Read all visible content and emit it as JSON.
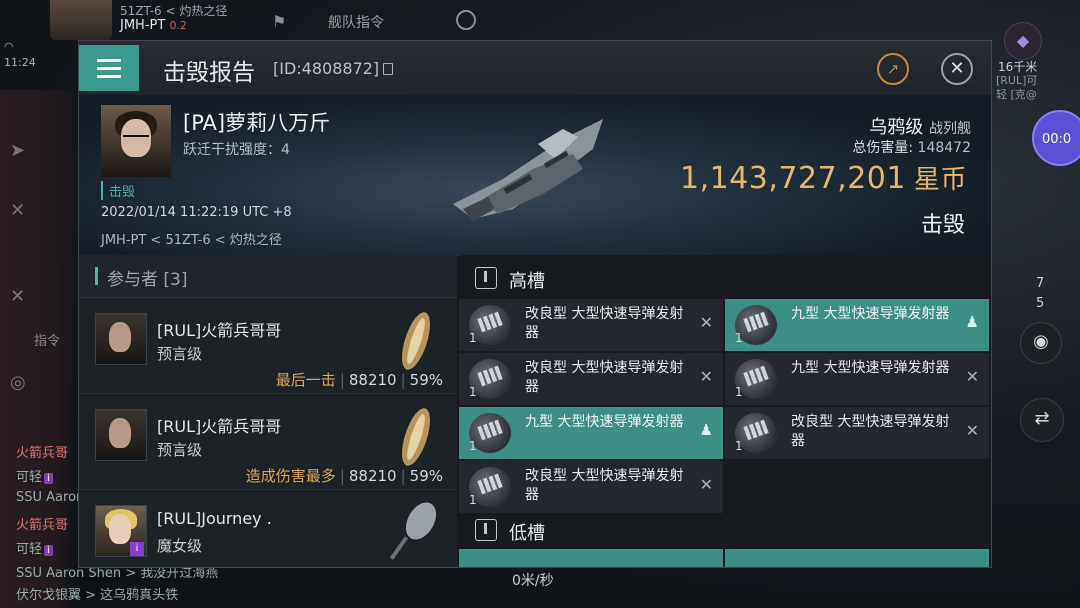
{
  "hud": {
    "location_line1": "51ZT-6 < 灼热之径",
    "location_system": "JMH-PT",
    "security": "0.2",
    "wifi": "",
    "time": "11:24",
    "fleet_label": "舰队指令",
    "right_distance": "16千米",
    "right_rul_line1": "[RUL]可",
    "right_rul_line2": "轻 [克@",
    "speed_button": "00:0",
    "right_count_1": "7",
    "right_count_2": "5",
    "side_label": "指令",
    "speed_bottom": "0米/秒",
    "chat": [
      {
        "name": "火箭兵哥",
        "text": ""
      },
      {
        "name": "",
        "text": "可轻",
        "tag": "i"
      },
      {
        "name": "",
        "text": "SSU Aaron"
      },
      {
        "name": "火箭兵哥",
        "text": ""
      },
      {
        "name": "",
        "text": "可轻",
        "tag": "i"
      },
      {
        "name": "",
        "text": "SSU Aaron Shen > 我没开过海燕"
      },
      {
        "name": "",
        "text": "伏尔戈银翼 > 这乌鸦真头铁"
      }
    ]
  },
  "report": {
    "title": "击毁报告",
    "id": "[ID:4808872]",
    "victim": {
      "name": "[PA]萝莉八万斤",
      "warp": "跃迁干扰强度：4",
      "status": "击毁",
      "datetime": "2022/01/14 11:22:19 UTC +8",
      "location": "JMH-PT < 51ZT-6 < 灼热之径",
      "ship": "乌鸦级",
      "ship_class": "战列舰",
      "damage_label": "总伤害量:",
      "damage_value": "148472",
      "isk_value": "1,143,727,201",
      "isk_unit": "星币",
      "result": "击毁"
    },
    "participants": {
      "title": "参与者 [3]",
      "rows": [
        {
          "name": "[RUL]火箭兵哥哥",
          "ship": "预言级",
          "tag": "最后一击",
          "damage": "88210",
          "percent": "59%"
        },
        {
          "name": "[RUL]火箭兵哥哥",
          "ship": "预言级",
          "tag": "造成伤害最多",
          "damage": "88210",
          "percent": "59%"
        },
        {
          "name": "[RUL]Journey .",
          "ship": "魔女级",
          "tag": "",
          "damage": "",
          "percent": ""
        }
      ]
    },
    "high_slots": {
      "title": "高槽",
      "modules": [
        {
          "name": "改良型 大型快速导弹发射器",
          "qty": "1",
          "highlight": false,
          "state": "destroyed"
        },
        {
          "name": "九型 大型快速导弹发射器",
          "qty": "1",
          "highlight": true,
          "state": "dropped"
        },
        {
          "name": "改良型 大型快速导弹发射器",
          "qty": "1",
          "highlight": false,
          "state": "destroyed"
        },
        {
          "name": "九型 大型快速导弹发射器",
          "qty": "1",
          "highlight": false,
          "state": "destroyed"
        },
        {
          "name": "九型 大型快速导弹发射器",
          "qty": "1",
          "highlight": true,
          "state": "dropped"
        },
        {
          "name": "改良型 大型快速导弹发射器",
          "qty": "1",
          "highlight": false,
          "state": "destroyed"
        },
        {
          "name": "改良型 大型快速导弹发射器",
          "qty": "1",
          "highlight": false,
          "state": "destroyed"
        }
      ]
    },
    "low_slots": {
      "title": "低槽"
    }
  }
}
